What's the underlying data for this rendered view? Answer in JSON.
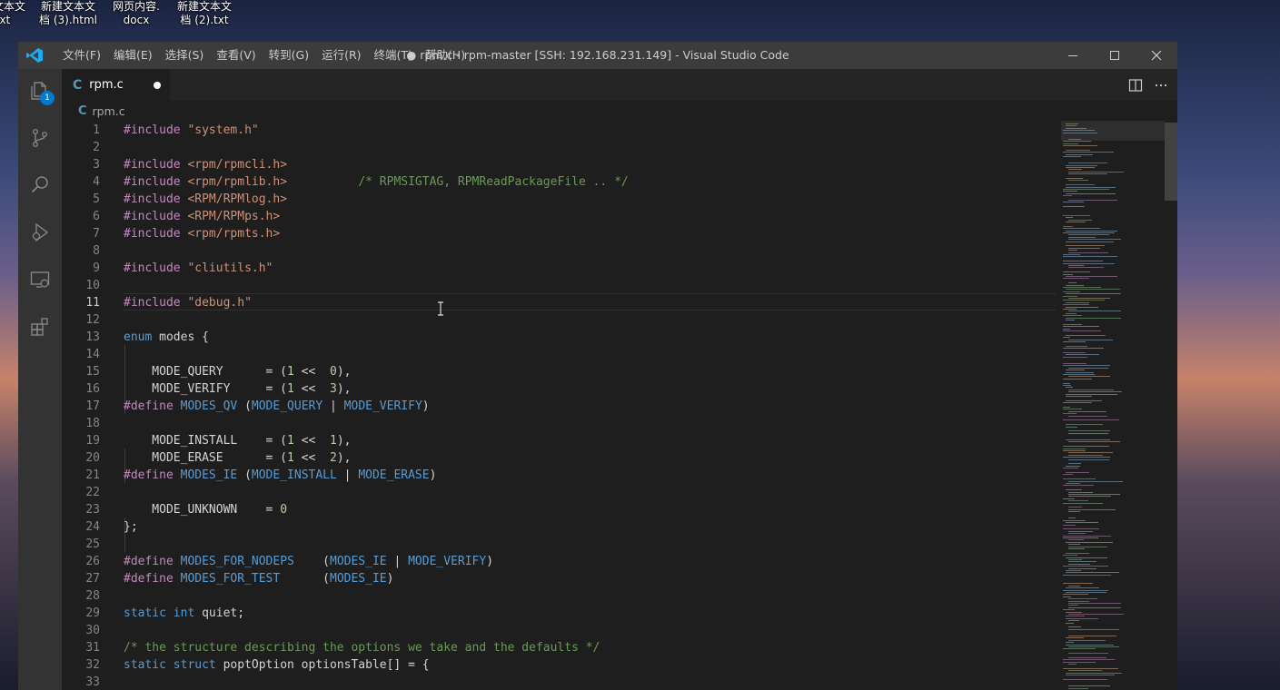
{
  "desktop": {
    "icons": [
      {
        "line1": "文本文",
        "line2": "txt"
      },
      {
        "line1": "新建文本文",
        "line2": "档 (3).html"
      },
      {
        "line1": "网页内容.",
        "line2": "docx"
      },
      {
        "line1": "新建文本文",
        "line2": "档 (2).txt"
      }
    ]
  },
  "titlebar": {
    "menu": [
      "文件(F)",
      "编辑(E)",
      "选择(S)",
      "查看(V)",
      "转到(G)",
      "运行(R)",
      "终端(T)",
      "帮助(H)"
    ],
    "title": "● rpm.c - rpm-master [SSH: 192.168.231.149] - Visual Studio Code"
  },
  "activity": {
    "explorer_badge": "1"
  },
  "tab": {
    "label": "rpm.c"
  },
  "breadcrumb": {
    "file": "rpm.c"
  },
  "editor": {
    "active_line": 11,
    "lines": [
      {
        "n": "1",
        "text": "#include \"system.h\""
      },
      {
        "n": "2",
        "text": ""
      },
      {
        "n": "3",
        "text": "#include <rpm/rpmcli.h>"
      },
      {
        "n": "4",
        "text": "#include <rpm/rpmlib.h>          /* RPMSIGTAG, RPMReadPackageFile .. */"
      },
      {
        "n": "5",
        "text": "#include <RPM/RPMlog.h>"
      },
      {
        "n": "6",
        "text": "#include <RPM/RPMps.h>"
      },
      {
        "n": "7",
        "text": "#include <rpm/rpmts.h>"
      },
      {
        "n": "8",
        "text": ""
      },
      {
        "n": "9",
        "text": "#include \"cliutils.h\""
      },
      {
        "n": "10",
        "text": ""
      },
      {
        "n": "11",
        "text": "#include \"debug.h\""
      },
      {
        "n": "12",
        "text": ""
      },
      {
        "n": "13",
        "text": "enum modes {"
      },
      {
        "n": "14",
        "text": ""
      },
      {
        "n": "15",
        "text": "    MODE_QUERY      = (1 <<  0),"
      },
      {
        "n": "16",
        "text": "    MODE_VERIFY     = (1 <<  3),"
      },
      {
        "n": "17",
        "text": "#define MODES_QV (MODE_QUERY | MODE_VERIFY)"
      },
      {
        "n": "18",
        "text": ""
      },
      {
        "n": "19",
        "text": "    MODE_INSTALL    = (1 <<  1),"
      },
      {
        "n": "20",
        "text": "    MODE_ERASE      = (1 <<  2),"
      },
      {
        "n": "21",
        "text": "#define MODES_IE (MODE_INSTALL | MODE_ERASE)"
      },
      {
        "n": "22",
        "text": ""
      },
      {
        "n": "23",
        "text": "    MODE_UNKNOWN    = 0"
      },
      {
        "n": "24",
        "text": "};"
      },
      {
        "n": "25",
        "text": ""
      },
      {
        "n": "26",
        "text": "#define MODES_FOR_NODEPS    (MODES_IE | MODE_VERIFY)"
      },
      {
        "n": "27",
        "text": "#define MODES_FOR_TEST      (MODES_IE)"
      },
      {
        "n": "28",
        "text": ""
      },
      {
        "n": "29",
        "text": "static int quiet;"
      },
      {
        "n": "30",
        "text": ""
      },
      {
        "n": "31",
        "text": "/* the structure describing the options we take and the defaults */"
      },
      {
        "n": "32",
        "text": "static struct poptOption optionsTable[] = {"
      },
      {
        "n": "33",
        "text": ""
      }
    ]
  },
  "colors": {
    "background": "#1e1e1e",
    "titlebar": "#3c3c3c",
    "activitybar": "#333333",
    "accent": "#007acc",
    "preprocessor": "#c586c0",
    "string": "#ce9178",
    "comment": "#6a9955",
    "keyword": "#569cd6",
    "number": "#b5cea8"
  },
  "icons": {
    "logo": "vscode-logo-icon",
    "activity": [
      "files-icon",
      "source-control-icon",
      "search-icon",
      "run-debug-icon",
      "remote-explorer-icon",
      "extensions-icon"
    ],
    "tab_actions": [
      "split-editor-icon",
      "more-actions-icon"
    ],
    "window": [
      "minimize-icon",
      "maximize-icon",
      "close-icon"
    ]
  }
}
